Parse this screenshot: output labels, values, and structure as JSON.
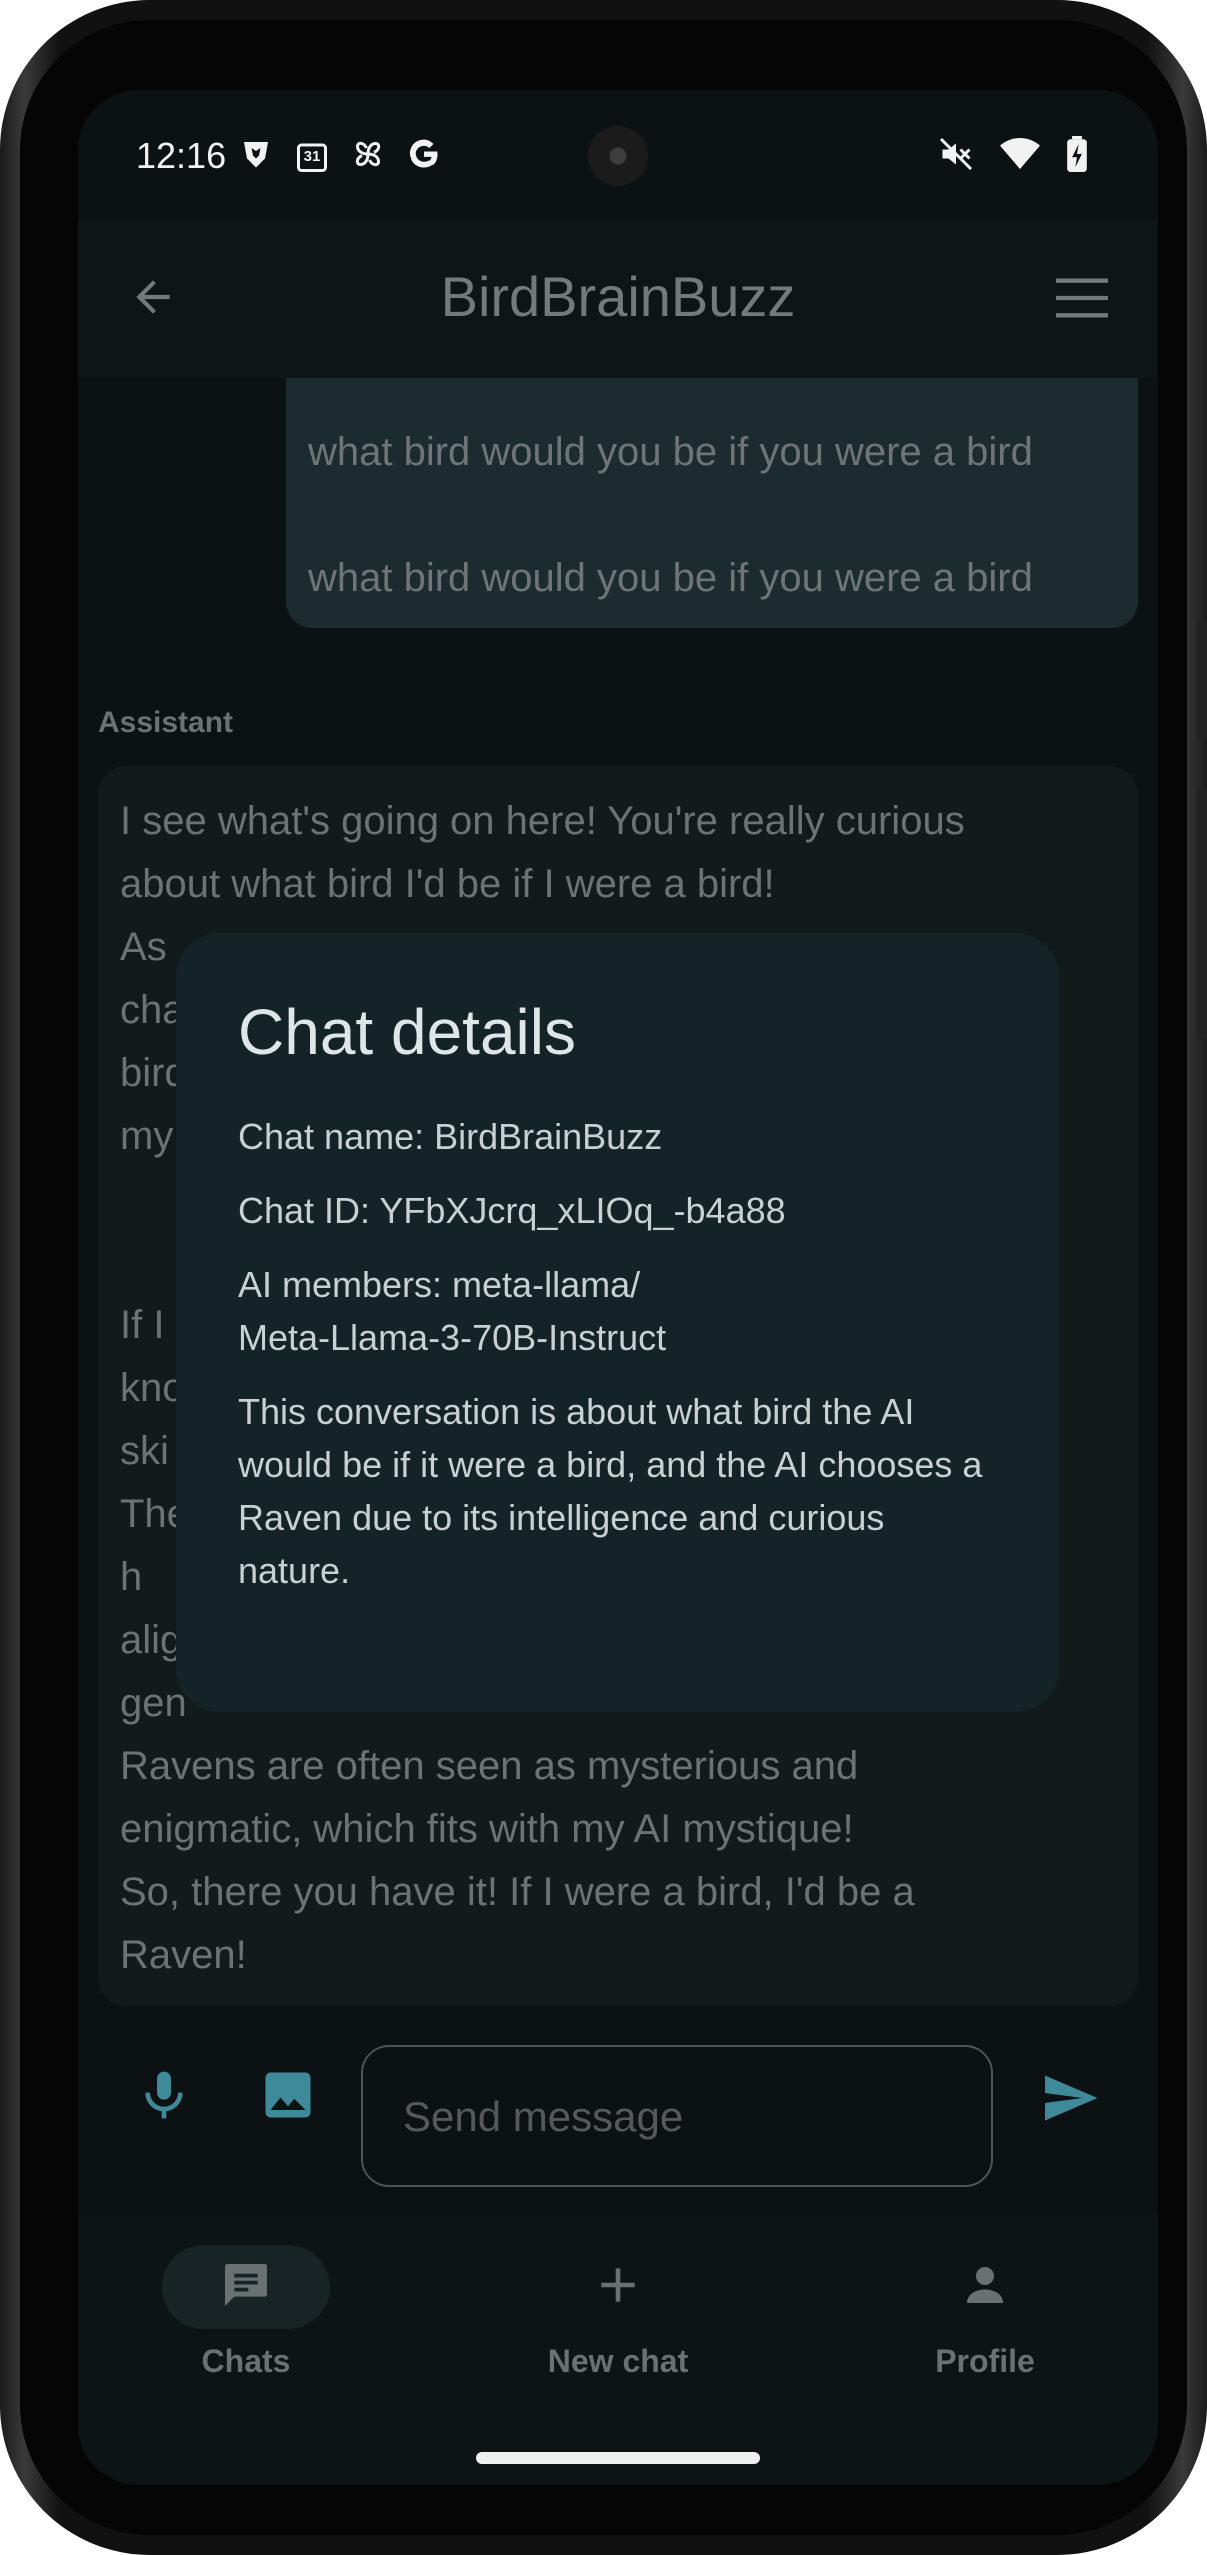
{
  "status_bar": {
    "time": "12:16",
    "left_icons": [
      "brave-icon",
      "calendar-icon",
      "pinwheel-icon",
      "google-icon"
    ],
    "calendar_day": "31",
    "right_icons": [
      "mute-icon",
      "wifi-icon",
      "battery-charging-icon"
    ]
  },
  "app_bar": {
    "title": "BirdBrainBuzz"
  },
  "chat": {
    "user_messages": [
      "what bird would you be if you were a bird",
      "what bird would you be if you were a bird"
    ],
    "assistant_label": "Assistant",
    "assistant_paragraphs": [
      "I see what's going on here! You're really curious\nabout what bird I'd be if I were a bird!",
      "As\ncha\nbird\nmy",
      "If I\nkno\nski\nThe                                                                                              h\nalig\ngen\nRavens are often seen as mysterious and\nenigmatic, which fits with my AI mystique!",
      "So, there you have it! If I were a bird, I'd be a\nRaven!"
    ]
  },
  "input": {
    "placeholder": "Send message"
  },
  "bottom_nav": {
    "items": [
      {
        "label": "Chats",
        "icon": "chat-icon",
        "active": true
      },
      {
        "label": "New chat",
        "icon": "plus-icon",
        "active": false
      },
      {
        "label": "Profile",
        "icon": "person-icon",
        "active": false
      }
    ]
  },
  "dialog": {
    "title": "Chat details",
    "chat_name": "Chat name: BirdBrainBuzz",
    "chat_id": "Chat ID: YFbXJcrq_xLIOq_-b4a88",
    "ai_members_line1": "AI members: meta-llama/",
    "ai_members_line2": "Meta-Llama-3-70B-Instruct",
    "summary": "This conversation is about what bird the AI would be if it were a bird, and the AI chooses a Raven due to its intelligence and curious nature."
  },
  "colors": {
    "accent": "#3e8a98",
    "dialog_bg": "#142326",
    "screen_bg": "#0c1214"
  }
}
